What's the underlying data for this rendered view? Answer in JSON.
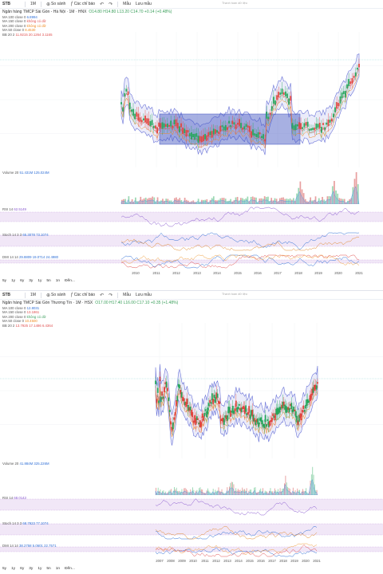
{
  "panels": [
    {
      "toolbar": {
        "symbol": "STB",
        "interval": "1M",
        "compare": "So sánh",
        "indicators": "Các chỉ báo",
        "templates": "Mẫu",
        "save": "Lưu mẫu"
      },
      "legend": {
        "title": "Ngân hàng TMCP Sài Gòn - Hà Nội · 1M · HNX",
        "ohlc": "O14.80 H14.80 L13.20 C14.70 +0.14 (+0.48%)",
        "lines": [
          {
            "label": "MA 100 close 0",
            "value": "6.8994",
            "color": "#2f6fd6"
          },
          {
            "label": "MA 150 close 0",
            "value": "không có dữ",
            "color": "#e05050"
          },
          {
            "label": "MA 200 close 0",
            "value": "không có dữ",
            "color": "#f08a20"
          },
          {
            "label": "MA 50 close 0",
            "value": "8.4530",
            "color": "#f08a20"
          },
          {
            "label": "BB 20 2",
            "value": "11.9215  20.1264  3.1165",
            "color": "#e05050"
          }
        ]
      },
      "watermark": "Thanh toán dữ liệu",
      "volume": {
        "label": "Volume 20",
        "values": "51.431M  125.024M"
      },
      "rsi": {
        "label": "RSI 14",
        "value": "62.5149"
      },
      "stoch": {
        "label": "Stoch 14 3 3",
        "values": "65.3078  73.1074"
      },
      "dmi": {
        "label": "DMI 14 14",
        "values": "29.8809  19.0714  24.4980"
      },
      "xaxis": [
        "2010",
        "2011",
        "2012",
        "2013",
        "2014",
        "2015",
        "2016",
        "2017",
        "2018",
        "2019",
        "2020",
        "2021"
      ],
      "ranges": [
        "5y",
        "1y",
        "6y",
        "3y",
        "1y",
        "5n",
        "1n",
        "Đến..."
      ]
    },
    {
      "toolbar": {
        "symbol": "STB",
        "interval": "1M",
        "compare": "So sánh",
        "indicators": "Các chỉ báo",
        "templates": "Mẫu",
        "save": "Lưu mẫu"
      },
      "legend": {
        "title": "Ngân hàng TMCP Sài Gòn Thương Tín · 1M · HSX",
        "ohlc": "O17.00 H17.40 L16.00 C17.10 +0.35 (+1.48%)",
        "lines": [
          {
            "label": "MA 100 close 0",
            "value": "12.8031",
            "color": "#2f6fd6"
          },
          {
            "label": "MA 150 close 0",
            "value": "13.1861",
            "color": "#e05050"
          },
          {
            "label": "MA 200 close 0",
            "value": "không có dữ",
            "color": "#f08a20"
          },
          {
            "label": "MA 50 close 0",
            "value": "10.4500",
            "color": "#f08a20"
          },
          {
            "label": "BB 20 2",
            "value": "13.7925  17.1486  6.4364",
            "color": "#e05050"
          }
        ]
      },
      "watermark": "Thanh toán dữ liệu",
      "volume": {
        "label": "Volume 20",
        "values": "41.884M  325.226M"
      },
      "rsi": {
        "label": "RSI 14",
        "value": "68.0143"
      },
      "stoch": {
        "label": "Stoch 14 3 3",
        "values": "68.7923  77.1074"
      },
      "dmi": {
        "label": "DMI 14 14",
        "values": "38.2758  5.0601  22.7571"
      },
      "xaxis": [
        "2007",
        "2008",
        "2009",
        "2010",
        "2011",
        "2012",
        "2013",
        "2014",
        "2015",
        "2016",
        "2017",
        "2018",
        "2019",
        "2020",
        "2021"
      ],
      "ranges": [
        "5y",
        "1y",
        "6y",
        "3y",
        "1y",
        "5n",
        "1n",
        "Đến..."
      ]
    }
  ]
}
